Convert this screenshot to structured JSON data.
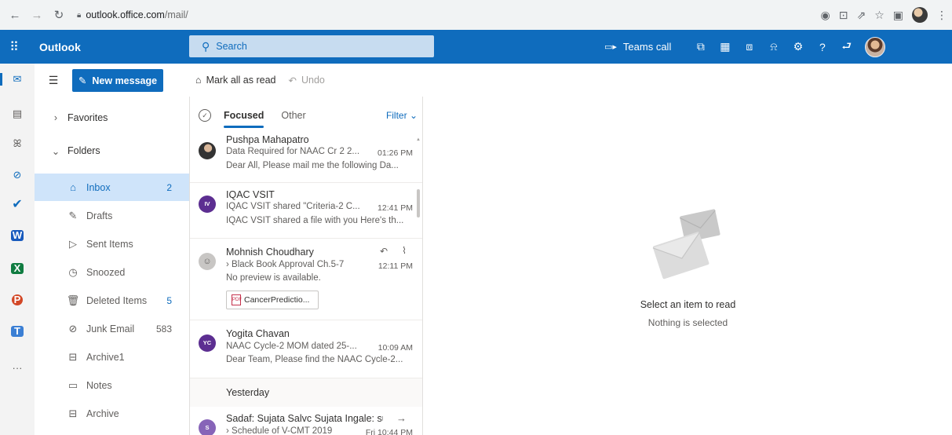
{
  "browser": {
    "url_domain": "outlook.office.com",
    "url_path": "/mail/"
  },
  "header": {
    "app_name": "Outlook",
    "search_placeholder": "Search",
    "teams_call_label": "Teams call",
    "help_glyph": "?"
  },
  "rail": {
    "more_glyph": "···"
  },
  "folder_pane": {
    "new_message_label": "New message",
    "favorites_label": "Favorites",
    "folders_label": "Folders",
    "folders": [
      {
        "label": "Inbox",
        "count": "2"
      },
      {
        "label": "Drafts",
        "count": ""
      },
      {
        "label": "Sent Items",
        "count": ""
      },
      {
        "label": "Snoozed",
        "count": ""
      },
      {
        "label": "Deleted Items",
        "count": "5"
      },
      {
        "label": "Junk Email",
        "count": "583"
      },
      {
        "label": "Archive1",
        "count": ""
      },
      {
        "label": "Notes",
        "count": ""
      },
      {
        "label": "Archive",
        "count": ""
      }
    ]
  },
  "command_bar": {
    "mark_all_read": "Mark all as read",
    "undo": "Undo"
  },
  "message_list": {
    "tab_focused": "Focused",
    "tab_other": "Other",
    "filter_label": "Filter",
    "messages": [
      {
        "sender": "Pushpa Mahapatro",
        "subject": "Data Required for NAAC Cr 2 2...",
        "time": "01:26 PM",
        "preview": "Dear All, Please mail me the following Da..."
      },
      {
        "initials": "IV",
        "sender": "IQAC VSIT",
        "subject": "IQAC VSIT shared \"Criteria-2 C...",
        "time": "12:41 PM",
        "preview": "IQAC VSIT shared a file with you Here's th..."
      },
      {
        "sender": "Mohnish Choudhary",
        "subject": "Black Book Approval Ch.5-7",
        "time": "12:11 PM",
        "preview": "No preview is available.",
        "attachment": "CancerPredictio..."
      },
      {
        "initials": "YC",
        "sender": "Yogita Chavan",
        "subject": "NAAC Cycle-2 MOM dated 25-...",
        "time": "10:09 AM",
        "preview": "Dear Team, Please find the NAAC Cycle-2..."
      },
      {
        "initials": "S",
        "sender": "Sadaf: Sujata Salvc Sujata Ingale: su...",
        "subject": "Schedule of V-CMT 2019",
        "time": "Fri 10:44 PM"
      }
    ],
    "yesterday_label": "Yesterday"
  },
  "reading_pane": {
    "empty_title": "Select an item to read",
    "empty_subtitle": "Nothing is selected"
  },
  "colors": {
    "brand": "#0f6cbd",
    "selected_bg": "#cfe4fa",
    "avatar_iv": "#5c2e91",
    "avatar_yc": "#5c2e91",
    "avatar_s": "#8764b8"
  }
}
